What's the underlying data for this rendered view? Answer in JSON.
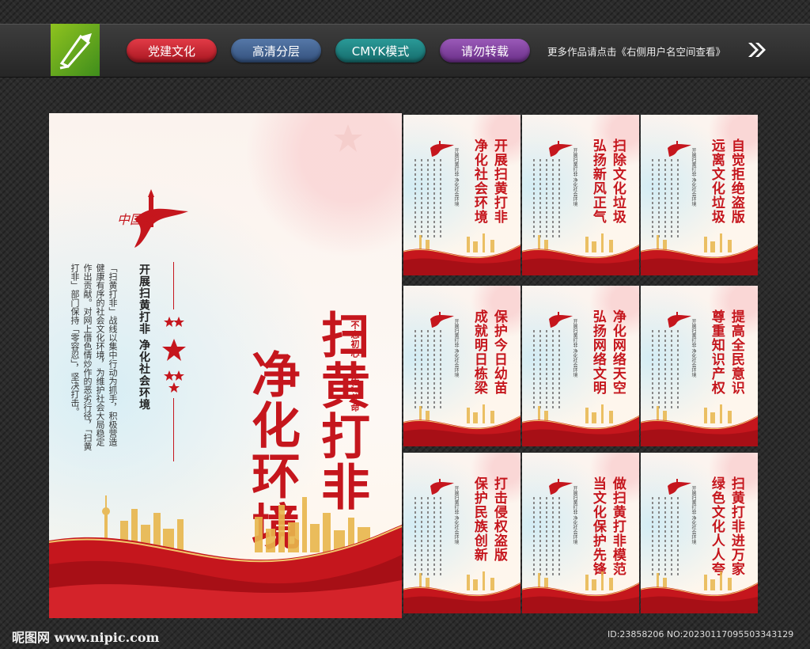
{
  "header": {
    "tags": [
      "党建文化",
      "高清分层",
      "CMYK模式",
      "请勿转载"
    ],
    "more_text": "更多作品请点击《右侧用户名空间查看》",
    "arrow_icon": "double-chevron-right-icon"
  },
  "main_poster": {
    "title_col1": "扫黄打非",
    "title_col2": "净化环境",
    "subtitle": "开展扫黄打非 净化社会环境",
    "body": "「扫黄打非」战线以集中行动为抓手，积极营造健康有序的社会文化环境，为维护社会大局稳定作出贡献。对网上借色情炒作的恶劣行径，「扫黄打非」部门保持「零容忍」，坚决打击。",
    "motto_1": "不忘初心",
    "motto_2": "牢记使命",
    "logo_text": "中国梦"
  },
  "small_posters": [
    {
      "line1": "开展扫黄打非",
      "line2": "净化社会环境",
      "small": "开展扫黄打非 净化社会环境"
    },
    {
      "line1": "扫除文化垃圾",
      "line2": "弘扬新风正气",
      "small": "开展扫黄打非 净化社会环境"
    },
    {
      "line1": "自觉拒绝盗版",
      "line2": "远离文化垃圾",
      "small": "开展扫黄打非 净化社会环境"
    },
    {
      "line1": "保护今日幼苗",
      "line2": "成就明日栋梁",
      "small": "开展扫黄打非 净化社会环境"
    },
    {
      "line1": "净化网络天空",
      "line2": "弘扬网络文明",
      "small": "开展扫黄打非 净化社会环境"
    },
    {
      "line1": "提高全民意识",
      "line2": "尊重知识产权",
      "small": "开展扫黄打非 净化社会环境"
    },
    {
      "line1": "打击侵权盗版",
      "line2": "保护民族创新",
      "small": "开展扫黄打非 净化社会环境"
    },
    {
      "line1": "做扫黄打非模范",
      "line2": "当文化保护先锋",
      "small": "开展扫黄打非 净化社会环境"
    },
    {
      "line1": "扫黄打非进万家",
      "line2": "绿色文化人人夸",
      "small": "开展扫黄打非 净化社会环境"
    }
  ],
  "footer": {
    "site": "昵图网 www.nipic.com",
    "id": "ID:23858206 NO:20230117095503343129"
  },
  "colors": {
    "red": "#c5161d",
    "gold": "#e8b64c",
    "bg": "#2b2b2b"
  }
}
